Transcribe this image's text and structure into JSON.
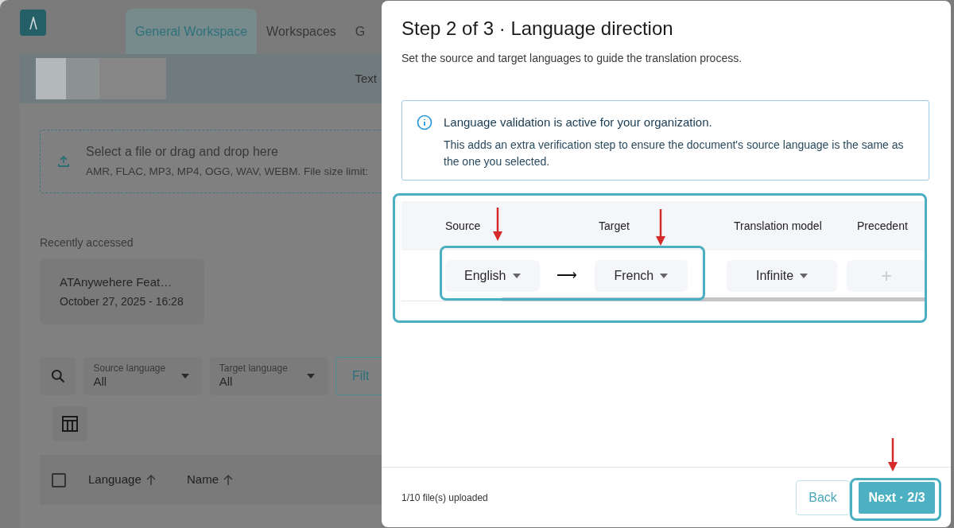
{
  "background_app": {
    "tabs": [
      {
        "label": "General Workspace",
        "selected": true
      },
      {
        "label": "Workspaces",
        "selected": false
      },
      {
        "label": "G",
        "selected": false
      }
    ],
    "banner_text": "Text",
    "upload": {
      "title": "Select a file or drag and drop here",
      "formats": "AMR, FLAC, MP3, MP4, OGG, WAV, WEBM. File size limit:"
    },
    "recent": {
      "heading": "Recently accessed",
      "items": [
        {
          "name": "ATAnywehere Feat…",
          "date": "October 27, 2025 - 16:28"
        }
      ]
    },
    "filters": [
      {
        "label": "Source language",
        "value": "All"
      },
      {
        "label": "Target language",
        "value": "All"
      }
    ],
    "filter_button": "Filt",
    "table": {
      "header_checked": false,
      "columns": [
        "Language",
        "Name"
      ]
    }
  },
  "dialog": {
    "title": "Step 2 of 3 · Language direction",
    "subtitle": "Set the source and target languages to guide the translation process.",
    "notice": {
      "title": "Language validation is active for your organization.",
      "body": "This adds an extra verification step to ensure the document's source language is the same as the one you selected."
    },
    "table": {
      "columns": [
        "Source",
        "Target",
        "Translation model",
        "Precedent"
      ],
      "row": {
        "source": "English",
        "arrow": "⟶",
        "target": "French",
        "model": "Infinite",
        "precedent": "+"
      }
    },
    "footer": {
      "status": "1/10 file(s) uploaded",
      "buttons": [
        {
          "label": "Back",
          "kind": "secondary"
        },
        {
          "label": "Next · 2/3",
          "kind": "primary"
        }
      ]
    }
  }
}
